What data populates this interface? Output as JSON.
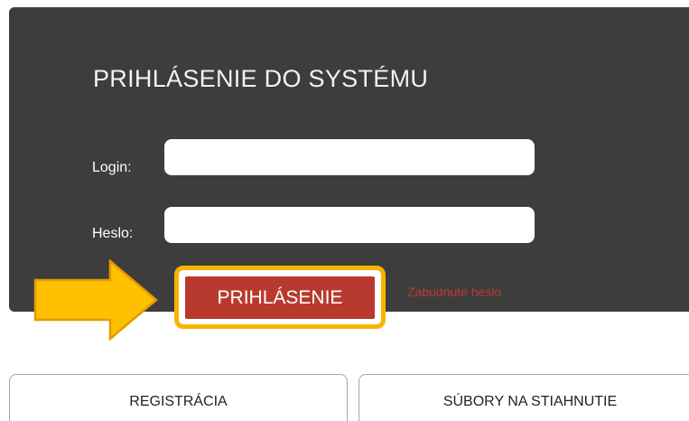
{
  "login_panel": {
    "title": "PRIHLÁSENIE DO SYSTÉMU",
    "login_label": "Login:",
    "login_value": "",
    "password_label": "Heslo:",
    "password_value": "",
    "submit_label": "PRIHLÁSENIE",
    "forgot_password_label": "Zabudnuté heslo"
  },
  "nav": {
    "register_label": "REGISTRÁCIA",
    "downloads_label": "SÚBORY NA STIAHNUTIE"
  },
  "annotation": {
    "arrow_icon": "arrow-right-icon",
    "highlight_color": "#f7b500"
  },
  "colors": {
    "panel_background": "#3d3d3d",
    "button_red": "#b83a2e",
    "link_red": "#c0392b"
  }
}
